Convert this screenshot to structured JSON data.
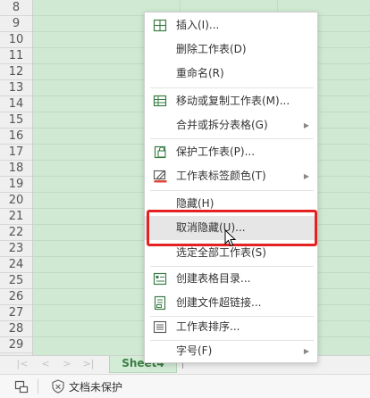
{
  "rows": [
    "8",
    "9",
    "10",
    "11",
    "12",
    "13",
    "14",
    "15",
    "16",
    "17",
    "18",
    "19",
    "20",
    "21",
    "22",
    "23",
    "24",
    "25",
    "26",
    "27",
    "28",
    "29"
  ],
  "sheet_tab": {
    "label": "Sheet4"
  },
  "status": {
    "protect_label": "文档未保护"
  },
  "menu": {
    "items": [
      {
        "label": "插入(I)...",
        "icon": "insert-sheet-icon"
      },
      {
        "label": "删除工作表(D)"
      },
      {
        "label": "重命名(R)"
      },
      {
        "label": "移动或复制工作表(M)...",
        "icon": "move-copy-icon"
      },
      {
        "label": "合并或拆分表格(G)",
        "submenu": true
      },
      {
        "label": "保护工作表(P)...",
        "icon": "protect-sheet-icon"
      },
      {
        "label": "工作表标签颜色(T)",
        "icon": "tab-color-icon",
        "submenu": true
      },
      {
        "label": "隐藏(H)"
      },
      {
        "label": "取消隐藏(U)...",
        "highlighted": true
      },
      {
        "label": "选定全部工作表(S)"
      },
      {
        "label": "创建表格目录...",
        "icon": "table-directory-icon"
      },
      {
        "label": "创建文件超链接...",
        "icon": "file-hyperlink-icon"
      },
      {
        "label": "工作表排序...",
        "icon": "sheet-sort-icon"
      },
      {
        "label": "字号(F)",
        "submenu": true
      }
    ]
  },
  "colors": {
    "highlight_border": "#e52222",
    "accent_green": "#3a7d44",
    "grid_bg": "#cfe9d2"
  }
}
